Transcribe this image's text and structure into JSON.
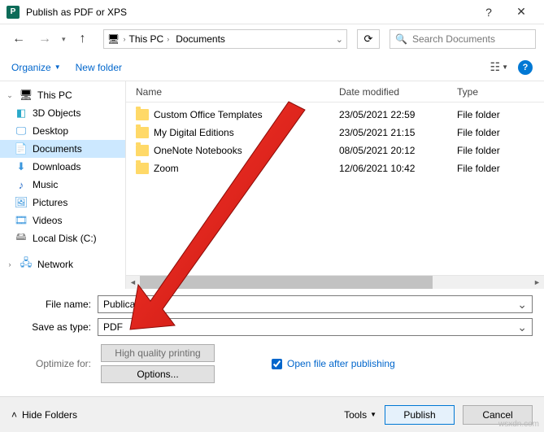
{
  "title": "Publish as PDF or XPS",
  "breadcrumb": {
    "seg1": "This PC",
    "seg2": "Documents"
  },
  "search": {
    "placeholder": "Search Documents"
  },
  "toolbar": {
    "organize": "Organize",
    "newfolder": "New folder"
  },
  "columns": {
    "name": "Name",
    "date": "Date modified",
    "type": "Type"
  },
  "sidebar": {
    "root": "This PC",
    "items": [
      "3D Objects",
      "Desktop",
      "Documents",
      "Downloads",
      "Music",
      "Pictures",
      "Videos",
      "Local Disk (C:)"
    ],
    "network": "Network"
  },
  "files": [
    {
      "name": "Custom Office Templates",
      "date": "23/05/2021 22:59",
      "type": "File folder"
    },
    {
      "name": "My Digital Editions",
      "date": "23/05/2021 21:15",
      "type": "File folder"
    },
    {
      "name": "OneNote Notebooks",
      "date": "08/05/2021 20:12",
      "type": "File folder"
    },
    {
      "name": "Zoom",
      "date": "12/06/2021 10:42",
      "type": "File folder"
    }
  ],
  "form": {
    "filename_label": "File name:",
    "filename_value": "Publication2",
    "saveastype_label": "Save as type:",
    "saveastype_value": "PDF",
    "optimize_label": "Optimize for:",
    "optimize_value": "High quality printing",
    "options_btn": "Options...",
    "open_after": "Open file after publishing"
  },
  "footer": {
    "hide": "Hide Folders",
    "tools": "Tools",
    "publish": "Publish",
    "cancel": "Cancel"
  },
  "watermark": "wsxdn.com"
}
